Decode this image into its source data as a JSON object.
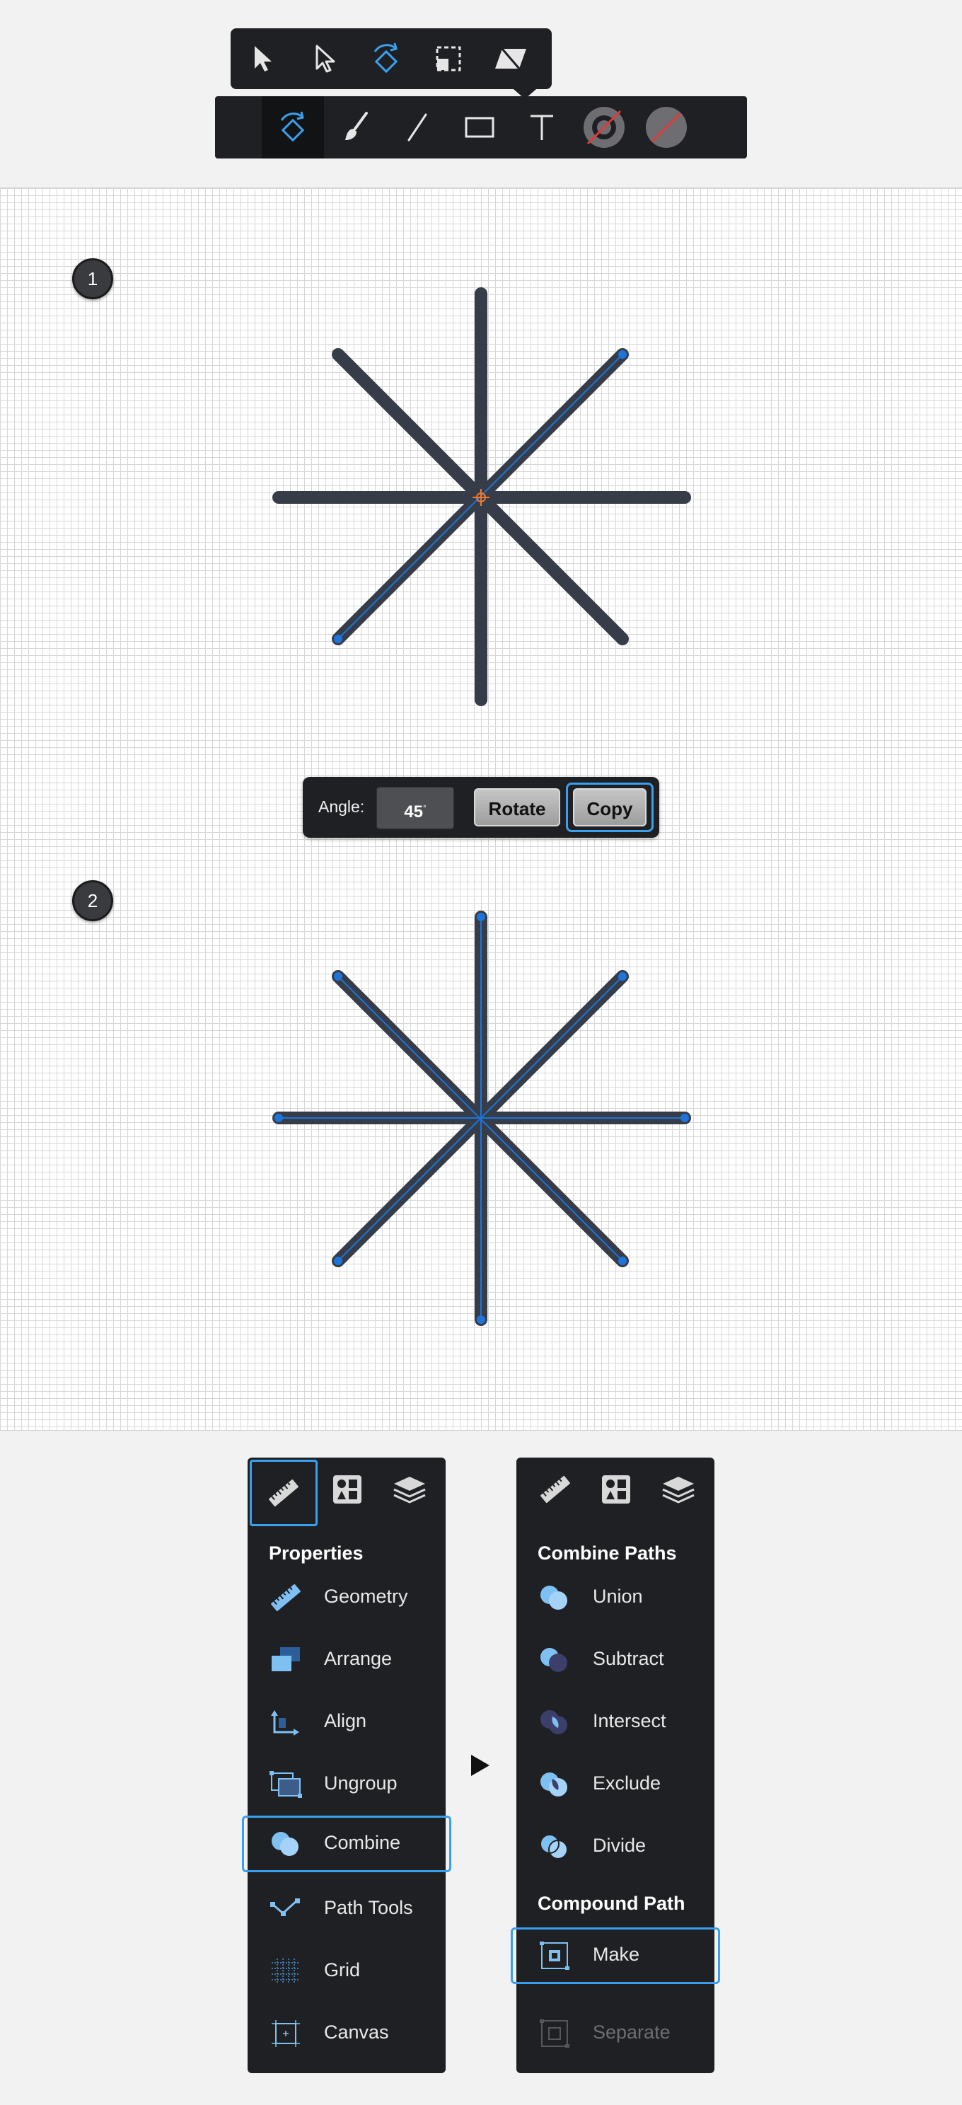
{
  "app": {
    "title": ""
  },
  "colors": {
    "panel_bg": "#1f2023",
    "accent": "#3aa0ee",
    "stroke": "#363c48",
    "path_highlight": "#1e74d8",
    "origin_marker": "#f07a2a"
  },
  "sub_toolbar": {
    "tools": [
      {
        "name": "select-arrow-icon"
      },
      {
        "name": "direct-select-arrow-icon"
      },
      {
        "name": "rotate-icon",
        "active": true
      },
      {
        "name": "scale-icon"
      },
      {
        "name": "skew-icon"
      }
    ]
  },
  "main_toolbar": {
    "tools": [
      {
        "name": "transform-rotate-icon",
        "active": true
      },
      {
        "name": "brush-icon"
      },
      {
        "name": "line-icon"
      },
      {
        "name": "rectangle-icon"
      },
      {
        "name": "text-icon"
      },
      {
        "name": "stroke-color-icon"
      },
      {
        "name": "fill-none-icon"
      }
    ]
  },
  "steps": [
    {
      "number": "1"
    },
    {
      "number": "2"
    }
  ],
  "angle_panel": {
    "angle_label": "Angle:",
    "angle_value": "45",
    "degree_symbol": "°",
    "rotate_label": "Rotate",
    "copy_label": "Copy"
  },
  "properties_panel": {
    "tabs": [
      "ruler-icon",
      "shapes-icon",
      "layers-icon"
    ],
    "heading": "Properties",
    "items": [
      {
        "label": "Geometry",
        "icon": "ruler-icon"
      },
      {
        "label": "Arrange",
        "icon": "arrange-icon"
      },
      {
        "label": "Align",
        "icon": "align-icon"
      },
      {
        "label": "Ungroup",
        "icon": "ungroup-icon"
      },
      {
        "label": "Combine",
        "icon": "combine-icon",
        "selected": true
      },
      {
        "label": "Path Tools",
        "icon": "path-tools-icon"
      },
      {
        "label": "Grid",
        "icon": "grid-icon"
      },
      {
        "label": "Canvas",
        "icon": "canvas-icon"
      }
    ]
  },
  "combine_panel": {
    "tabs": [
      "ruler-icon",
      "shapes-icon",
      "layers-icon"
    ],
    "heading": "Combine Paths",
    "items": [
      {
        "label": "Union",
        "icon": "union-icon"
      },
      {
        "label": "Subtract",
        "icon": "subtract-icon"
      },
      {
        "label": "Intersect",
        "icon": "intersect-icon"
      },
      {
        "label": "Exclude",
        "icon": "exclude-icon"
      },
      {
        "label": "Divide",
        "icon": "divide-icon"
      }
    ],
    "compound_heading": "Compound Path",
    "compound_items": [
      {
        "label": "Make",
        "icon": "make-compound-icon",
        "selected": true
      },
      {
        "label": "Separate",
        "icon": "separate-compound-icon",
        "disabled": true
      }
    ]
  }
}
